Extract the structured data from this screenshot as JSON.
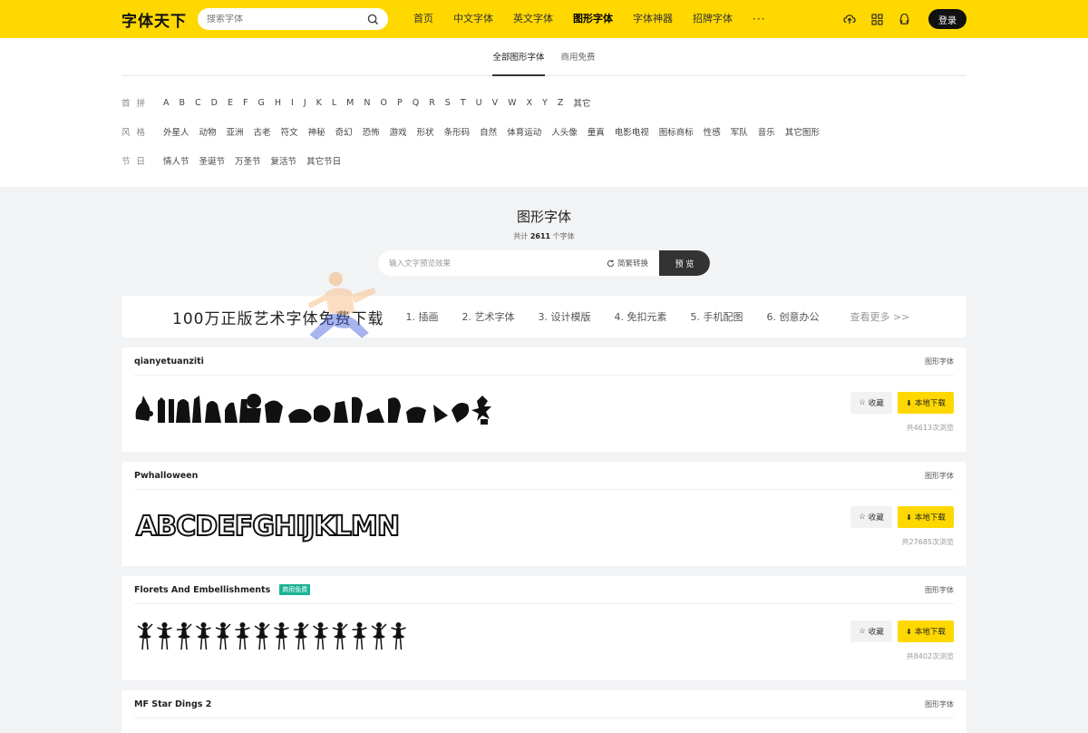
{
  "header": {
    "logo": "字体天下",
    "search_placeholder": "搜索字体",
    "nav": [
      "首页",
      "中文字体",
      "英文字体",
      "图形字体",
      "字体神器",
      "招牌字体"
    ],
    "nav_active": 3,
    "more": "···",
    "login": "登录",
    "icons": [
      "upload-cloud-icon",
      "apps-grid-icon",
      "qq-icon"
    ]
  },
  "tabs": [
    "全部图形字体",
    "商用免费"
  ],
  "filters": {
    "pinyin": {
      "label": "首拼",
      "items": [
        "A",
        "B",
        "C",
        "D",
        "E",
        "F",
        "G",
        "H",
        "I",
        "J",
        "K",
        "L",
        "M",
        "N",
        "O",
        "P",
        "Q",
        "R",
        "S",
        "T",
        "U",
        "V",
        "W",
        "X",
        "Y",
        "Z",
        "其它"
      ]
    },
    "style": {
      "label": "风格",
      "items": [
        "外星人",
        "动物",
        "亚洲",
        "古老",
        "符文",
        "神秘",
        "奇幻",
        "恐怖",
        "游戏",
        "形状",
        "条形码",
        "自然",
        "体育运动",
        "人头像",
        "童真",
        "电影电视",
        "图标商标",
        "性感",
        "军队",
        "音乐",
        "其它图形"
      ]
    },
    "festival": {
      "label": "节日",
      "items": [
        "情人节",
        "圣诞节",
        "万圣节",
        "复活节",
        "其它节日"
      ]
    }
  },
  "section": {
    "title": "图形字体",
    "count_prefix": "共计",
    "count": "2611",
    "count_suffix": "个字体",
    "preview_placeholder": "输入文字预览效果",
    "convert": "简繁转换",
    "preview_btn": "预 览"
  },
  "banner": {
    "title": "100万正版艺术字体免费下载",
    "items": [
      "1. 插画",
      "2. 艺术字体",
      "3. 设计模版",
      "4. 免扣元素",
      "5. 手机配图",
      "6. 创意办公"
    ],
    "more": "查看更多 >>"
  },
  "cards": [
    {
      "name": "qianyetuanziti",
      "badge": "",
      "category": "图形字体",
      "fav": "收藏",
      "download": "本地下载",
      "views": "共4613次浏览",
      "preview": "silhouettes"
    },
    {
      "name": "Pwhalloween",
      "badge": "",
      "category": "图形字体",
      "fav": "收藏",
      "download": "本地下载",
      "views": "共27685次浏览",
      "preview": "ABCDEFGHIJKLMN"
    },
    {
      "name": "Florets And Embellishments",
      "badge": "商用免费",
      "category": "图形字体",
      "fav": "收藏",
      "download": "本地下载",
      "views": "共8402次浏览",
      "preview": "dancers"
    },
    {
      "name": "MF Star Dings 2",
      "badge": "",
      "category": "图形字体"
    }
  ]
}
